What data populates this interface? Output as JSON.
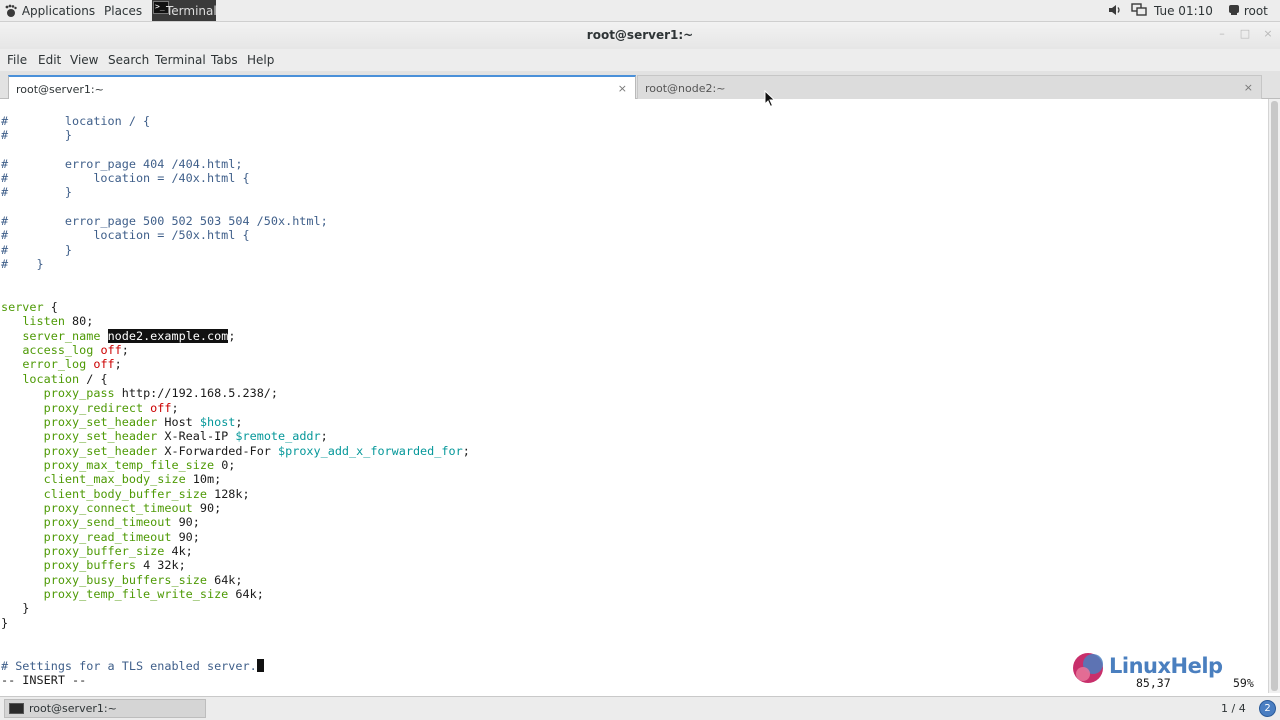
{
  "top_panel": {
    "applications": "Applications",
    "places": "Places",
    "task": "Terminal",
    "clock": "Tue 01:10",
    "user": "root"
  },
  "window": {
    "title": "root@server1:~"
  },
  "menubar": [
    "File",
    "Edit",
    "View",
    "Search",
    "Terminal",
    "Tabs",
    "Help"
  ],
  "tabs": [
    {
      "label": "root@server1:~",
      "close": "×"
    },
    {
      "label": "root@node2:~",
      "close": "×"
    }
  ],
  "terminal": {
    "lines": [
      {
        "t": "cm",
        "text": "#        location / {"
      },
      {
        "t": "cm",
        "text": "#        }"
      },
      {
        "t": "blank",
        "text": ""
      },
      {
        "t": "cm",
        "text": "#        error_page 404 /404.html;"
      },
      {
        "t": "cm",
        "text": "#            location = /40x.html {"
      },
      {
        "t": "cm",
        "text": "#        }"
      },
      {
        "t": "blank",
        "text": ""
      },
      {
        "t": "cm",
        "text": "#        error_page 500 502 503 504 /50x.html;"
      },
      {
        "t": "cm",
        "text": "#            location = /50x.html {"
      },
      {
        "t": "cm",
        "text": "#        }"
      },
      {
        "t": "cm",
        "text": "#    }"
      },
      {
        "t": "blank",
        "text": ""
      },
      {
        "t": "blank",
        "text": ""
      },
      {
        "t": "open",
        "indent": "",
        "kw": "server",
        "rest": " {"
      },
      {
        "t": "dir",
        "indent": "   ",
        "kw": "listen",
        "rest": " 80;"
      },
      {
        "t": "hl",
        "indent": "   ",
        "kw": "server_name",
        "pre": " ",
        "hl": "node2.example.com",
        "rest": ";"
      },
      {
        "t": "off",
        "indent": "   ",
        "kw": "access_log",
        "pre": " ",
        "val": "off",
        "rest": ";"
      },
      {
        "t": "off",
        "indent": "   ",
        "kw": "error_log",
        "pre": " ",
        "val": "off",
        "rest": ";"
      },
      {
        "t": "open",
        "indent": "   ",
        "kw": "location",
        "rest": " / {"
      },
      {
        "t": "dir",
        "indent": "      ",
        "kw": "proxy_pass",
        "rest": " http://192.168.5.238/;"
      },
      {
        "t": "off",
        "indent": "      ",
        "kw": "proxy_redirect",
        "pre": " ",
        "val": "off",
        "rest": ";"
      },
      {
        "t": "var",
        "indent": "      ",
        "kw": "proxy_set_header",
        "pre": " Host ",
        "val": "$host",
        "rest": ";"
      },
      {
        "t": "var",
        "indent": "      ",
        "kw": "proxy_set_header",
        "pre": " X-Real-IP ",
        "val": "$remote_addr",
        "rest": ";"
      },
      {
        "t": "var",
        "indent": "      ",
        "kw": "proxy_set_header",
        "pre": " X-Forwarded-For ",
        "val": "$proxy_add_x_forwarded_for",
        "rest": ";"
      },
      {
        "t": "dir",
        "indent": "      ",
        "kw": "proxy_max_temp_file_size",
        "rest": " 0;"
      },
      {
        "t": "dir",
        "indent": "      ",
        "kw": "client_max_body_size",
        "rest": " 10m;"
      },
      {
        "t": "dir",
        "indent": "      ",
        "kw": "client_body_buffer_size",
        "rest": " 128k;"
      },
      {
        "t": "dir",
        "indent": "      ",
        "kw": "proxy_connect_timeout",
        "rest": " 90;"
      },
      {
        "t": "dir",
        "indent": "      ",
        "kw": "proxy_send_timeout",
        "rest": " 90;"
      },
      {
        "t": "dir",
        "indent": "      ",
        "kw": "proxy_read_timeout",
        "rest": " 90;"
      },
      {
        "t": "dir",
        "indent": "      ",
        "kw": "proxy_buffer_size",
        "rest": " 4k;"
      },
      {
        "t": "dir",
        "indent": "      ",
        "kw": "proxy_buffers",
        "rest": " 4 32k;"
      },
      {
        "t": "dir",
        "indent": "      ",
        "kw": "proxy_busy_buffers_size",
        "rest": " 64k;"
      },
      {
        "t": "dir",
        "indent": "      ",
        "kw": "proxy_temp_file_write_size",
        "rest": " 64k;"
      },
      {
        "t": "plain",
        "text": "   }"
      },
      {
        "t": "plain",
        "text": "}"
      },
      {
        "t": "blank",
        "text": ""
      },
      {
        "t": "blank",
        "text": ""
      },
      {
        "t": "cursor",
        "text": "# Settings for a TLS enabled server."
      },
      {
        "t": "plain",
        "text": "-- INSERT --"
      }
    ],
    "cursor_position": "85,37",
    "scroll_percent": "59%"
  },
  "logo": {
    "text": "LinuxHelp"
  },
  "bottom_panel": {
    "task": "root@server1:~",
    "workspace": "1 / 4",
    "workspace_button": "2"
  }
}
